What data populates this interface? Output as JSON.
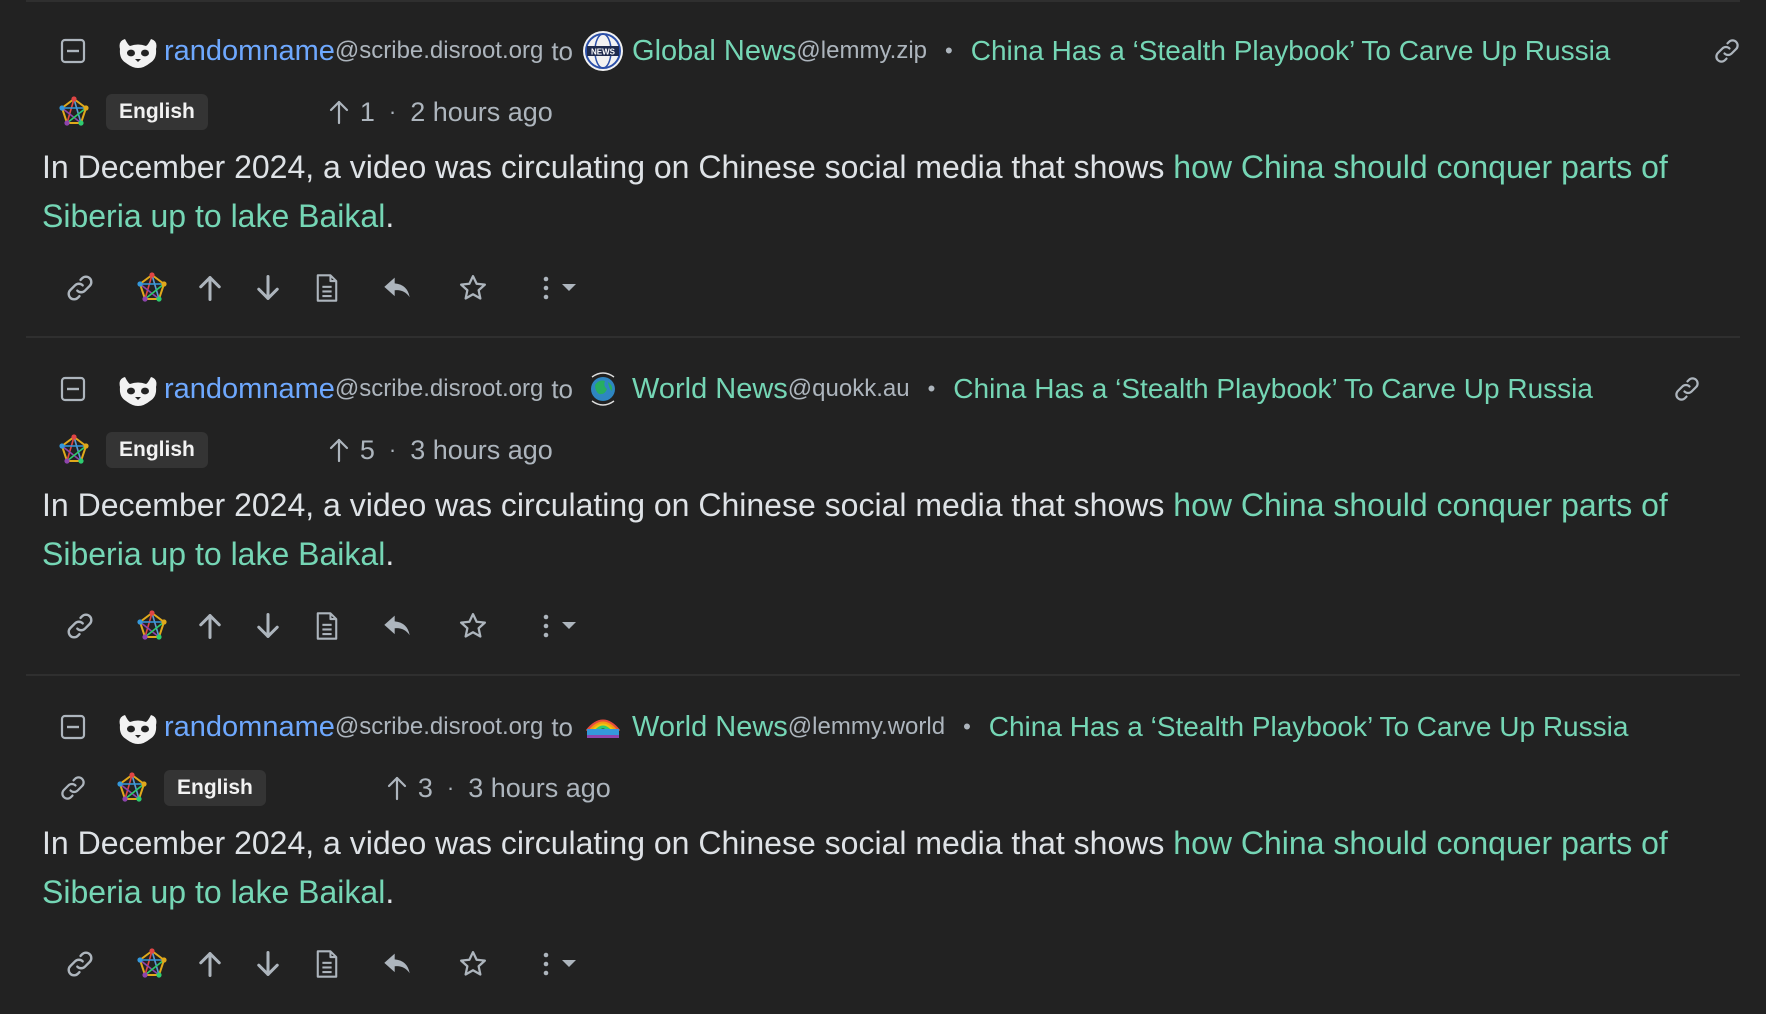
{
  "comments": [
    {
      "user": {
        "name": "randomname",
        "instance": "@scribe.disroot.org"
      },
      "to_label": "to",
      "community": {
        "name": "Global News",
        "instance": "@lemmy.zip",
        "icon": "global-news-icon"
      },
      "post_title": "China Has a ‘Stealth Playbook’ To Carve Up Russia",
      "language": "English",
      "score": "1",
      "time": "2 hours ago",
      "body_text": "In December 2024, a video was circulating on Chinese social media that shows ",
      "body_link_1": "how China should conquer parts of",
      "body_link_2": "Siberia up to lake Baikal",
      "body_end": "."
    },
    {
      "user": {
        "name": "randomname",
        "instance": "@scribe.disroot.org"
      },
      "to_label": "to",
      "community": {
        "name": "World News",
        "instance": "@quokk.au",
        "icon": "world-news-globe-icon"
      },
      "post_title": "China Has a ‘Stealth Playbook’ To Carve Up Russia",
      "language": "English",
      "score": "5",
      "time": "3 hours ago",
      "body_text": "In December 2024, a video was circulating on Chinese social media that shows ",
      "body_link_1": "how China should conquer parts of",
      "body_link_2": "Siberia up to lake Baikal",
      "body_end": "."
    },
    {
      "user": {
        "name": "randomname",
        "instance": "@scribe.disroot.org"
      },
      "to_label": "to",
      "community": {
        "name": "World News",
        "instance": "@lemmy.world",
        "icon": "world-news-rainbow-icon"
      },
      "post_title": "China Has a ‘Stealth Playbook’ To Carve Up Russia",
      "language": "English",
      "score": "3",
      "time": "3 hours ago",
      "body_text": "In December 2024, a video was circulating on Chinese social media that shows ",
      "body_link_1": "how China should conquer parts of",
      "body_link_2": "Siberia up to lake Baikal",
      "body_end": "."
    }
  ],
  "colors": {
    "background": "#222222",
    "user_link": "#6ea8fe",
    "community_link": "#75d6b5",
    "muted": "#adb5bd",
    "text": "#dee2e6",
    "badge_bg": "#343434"
  }
}
